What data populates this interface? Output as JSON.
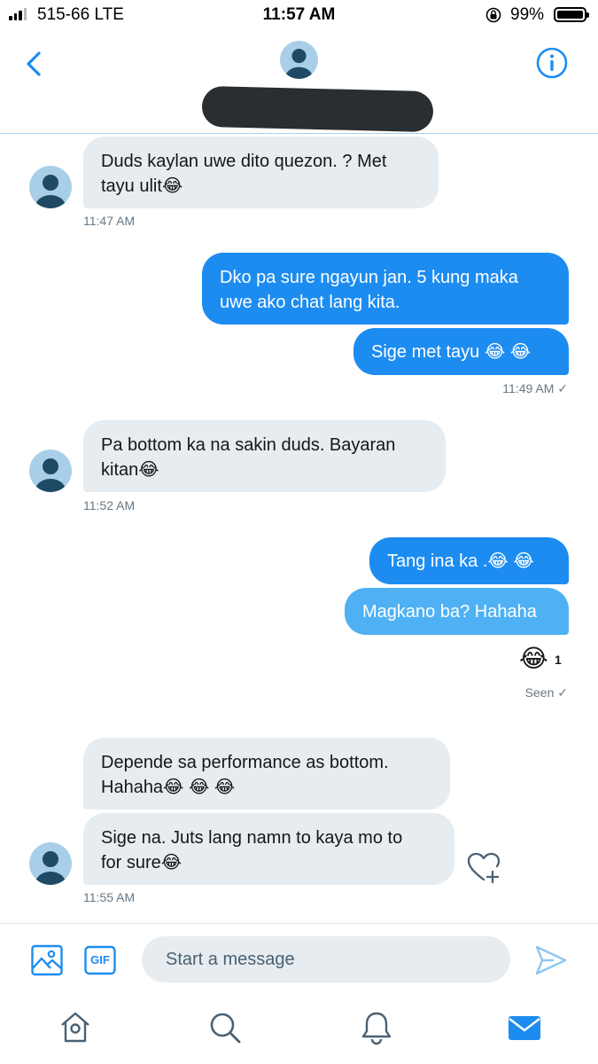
{
  "status_bar": {
    "carrier": "515-66  LTE",
    "time": "11:57 AM",
    "battery": "99%"
  },
  "header": {
    "back_icon": "chevron-left-icon",
    "info_icon": "info-circle-icon",
    "accent_color": "#1d8cf0"
  },
  "messages": [
    {
      "direction": "received",
      "text": "Duds kaylan uwe dito quezon. ? Met\ntayu ulit😂"
    },
    {
      "direction": "received",
      "time": "11:47 AM"
    },
    {
      "direction": "sent",
      "text": "Dko pa sure ngayun jan. 5 kung maka\nuwe ako chat lang kita."
    },
    {
      "direction": "sent",
      "text": "Sige met tayu 😂 😂",
      "time": "11:49 AM ✓"
    },
    {
      "direction": "received",
      "text": "Pa bottom ka na sakin duds. Bayaran\nkitan😂",
      "time": "11:52 AM"
    },
    {
      "direction": "sent",
      "text": "Tang ina ka .😂 😂"
    },
    {
      "direction": "sent",
      "text": "Magkano ba? Hahaha",
      "reaction": "😂",
      "reaction_count": "1",
      "status": "Seen ✓"
    },
    {
      "direction": "received",
      "text": "Depende sa performance  as bottom.\nHahaha😂 😂 😂"
    },
    {
      "direction": "received",
      "text": "Sige na. Juts lang namn to kaya mo to\nfor sure😂",
      "time": "11:55 AM"
    }
  ],
  "composer": {
    "placeholder": "Start a message",
    "gif_label": "GIF"
  },
  "tabs": [
    "home-icon",
    "search-icon",
    "notifications-icon",
    "messages-icon"
  ]
}
